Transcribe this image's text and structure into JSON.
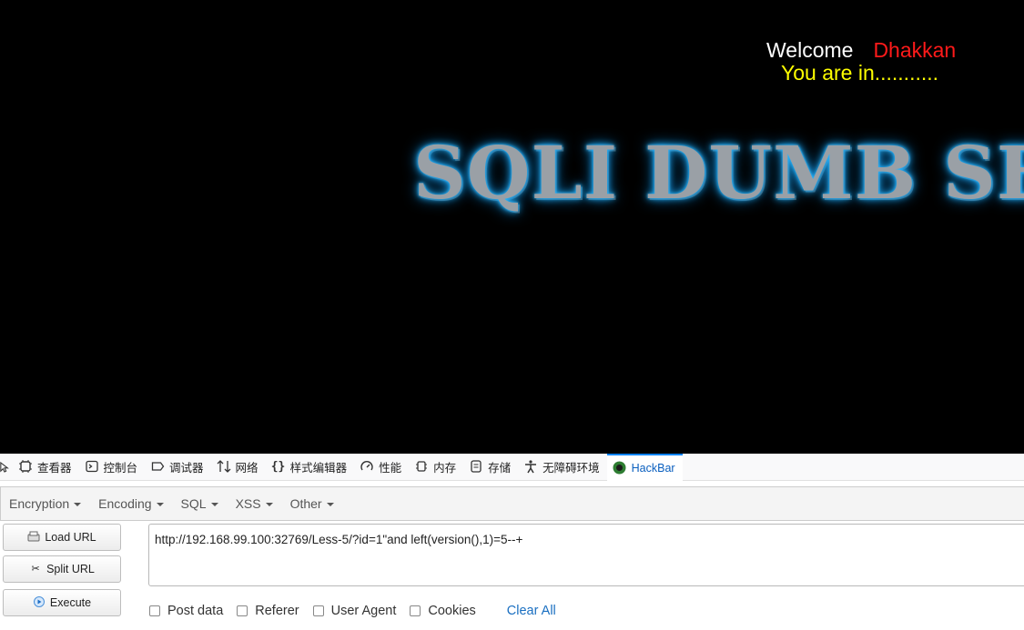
{
  "page": {
    "welcome": "Welcome",
    "username": "Dhakkan",
    "status": "You are in...........",
    "banner": "SQLI DUMB SERIES"
  },
  "devtools": {
    "tabs": [
      {
        "label": "查看器",
        "icon": "inspector-icon"
      },
      {
        "label": "控制台",
        "icon": "console-icon"
      },
      {
        "label": "调试器",
        "icon": "debugger-icon"
      },
      {
        "label": "网络",
        "icon": "network-icon"
      },
      {
        "label": "样式编辑器",
        "icon": "style-editor-icon"
      },
      {
        "label": "性能",
        "icon": "performance-icon"
      },
      {
        "label": "内存",
        "icon": "memory-icon"
      },
      {
        "label": "存储",
        "icon": "storage-icon"
      },
      {
        "label": "无障碍环境",
        "icon": "accessibility-icon"
      },
      {
        "label": "HackBar",
        "icon": "hackbar-icon"
      }
    ],
    "active_tab": "HackBar"
  },
  "hackbar": {
    "menu": [
      "Encryption",
      "Encoding",
      "SQL",
      "XSS",
      "Other"
    ],
    "buttons": {
      "load": "Load URL",
      "split": "Split URL",
      "execute": "Execute"
    },
    "url": "http://192.168.99.100:32769/Less-5/?id=1\"and left(version(),1)=5--+",
    "options": {
      "post_data": "Post data",
      "referer": "Referer",
      "user_agent": "User Agent",
      "cookies": "Cookies",
      "clear_all": "Clear All"
    },
    "colors": {
      "accent": "#0a84ff",
      "username": "#ff1a1a",
      "status": "#ffff00"
    }
  }
}
